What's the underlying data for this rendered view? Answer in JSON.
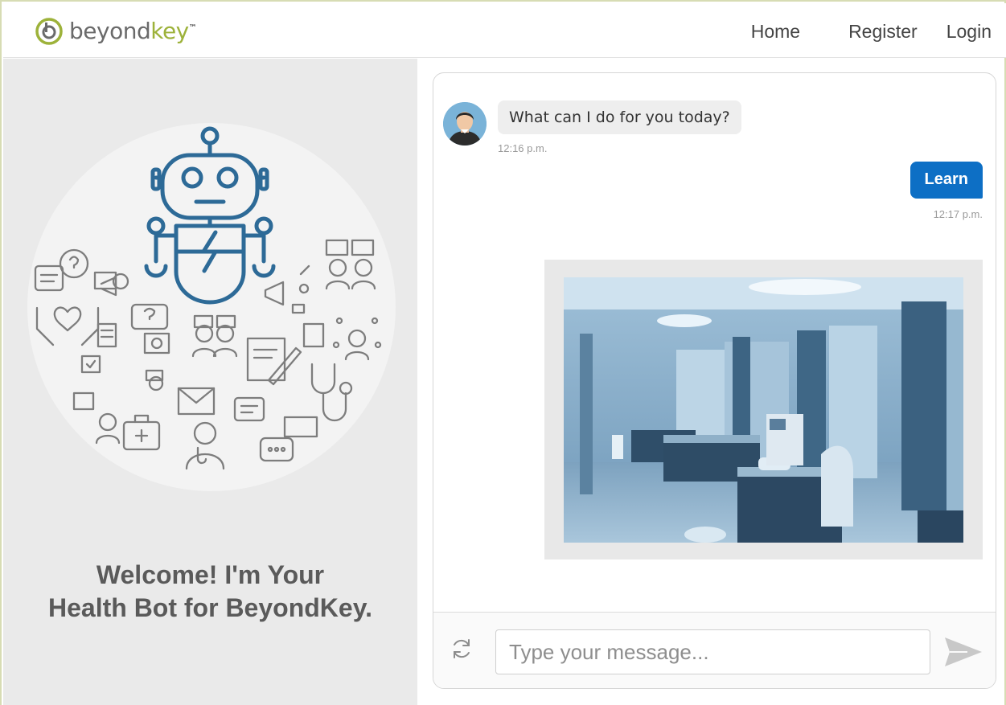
{
  "header": {
    "logo": {
      "text_main": "beyond",
      "text_accent": "key",
      "tm": "™"
    },
    "nav": [
      {
        "label": "Home"
      },
      {
        "label": "Register"
      },
      {
        "label": "Login"
      }
    ]
  },
  "left_panel": {
    "welcome_line1": "Welcome! I'm Your",
    "welcome_line2": "Health Bot for BeyondKey."
  },
  "chat": {
    "messages": [
      {
        "from": "bot",
        "text": "What can I do for you today?",
        "time": "12:16 p.m."
      },
      {
        "from": "user",
        "text": "Learn",
        "time": "12:17 p.m."
      }
    ],
    "input": {
      "placeholder": "Type your message...",
      "value": ""
    }
  },
  "colors": {
    "accent": "#0d6fc5",
    "logo_green": "#9db23a",
    "robot_blue": "#2d6a97"
  },
  "icons": {
    "refresh": "refresh-icon",
    "send": "send-icon",
    "avatar": "bot-avatar-icon"
  }
}
